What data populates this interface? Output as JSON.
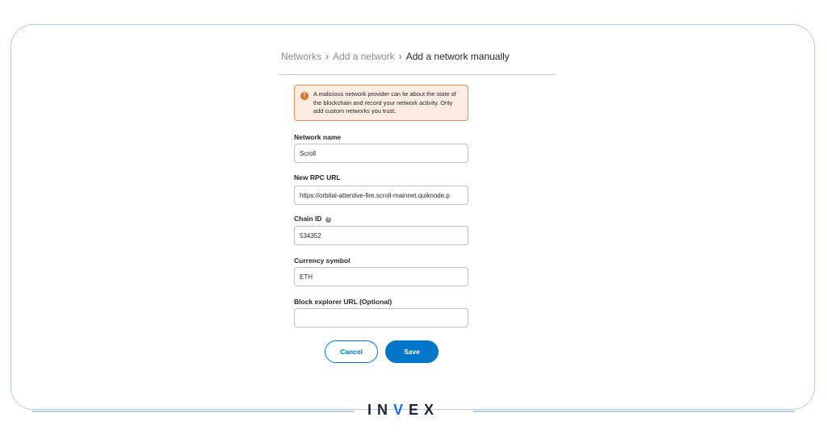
{
  "breadcrumb": {
    "items": [
      "Networks",
      "Add a network",
      "Add a network manually"
    ]
  },
  "warning": {
    "text": "A malicious network provider can lie about the state of the blockchain and record your network activity. Only add custom networks you trust."
  },
  "form": {
    "network_name": {
      "label": "Network name",
      "value": "Scroll"
    },
    "rpc_url": {
      "label": "New RPC URL",
      "value": "https://orbital-attentive-fire.scroll-mainnet.quiknode.p"
    },
    "chain_id": {
      "label": "Chain ID",
      "value": "534352"
    },
    "currency_symbol": {
      "label": "Currency symbol",
      "value": "ETH"
    },
    "block_explorer": {
      "label": "Block explorer URL (Optional)",
      "value": ""
    }
  },
  "buttons": {
    "cancel": "Cancel",
    "save": "Save"
  },
  "brand": {
    "left": "IN",
    "v": "V",
    "right": "EX"
  },
  "colors": {
    "accent": "#0376c9",
    "warning_border": "#e88f58",
    "warning_bg": "#fcebe1",
    "logo_blue": "#1f6fe5"
  }
}
